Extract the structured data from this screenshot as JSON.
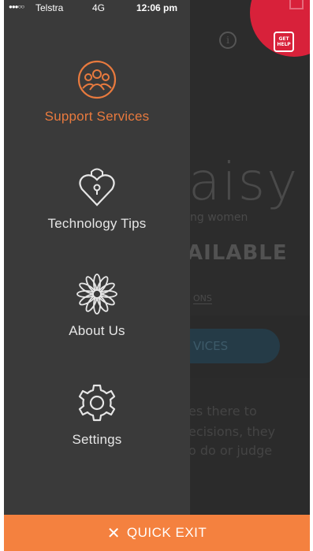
{
  "status_bar": {
    "signal": "●●●○○",
    "carrier": "Telstra",
    "network": "4G",
    "time": "12:06 pm"
  },
  "background": {
    "logo_text": "aisy",
    "tagline": "ng women",
    "available_text": "AILABLE",
    "options_text": "ONS",
    "services_button": "VICES",
    "body_lines": [
      "es there to",
      "ecisions, they",
      "o do or judge"
    ],
    "get_help_label_1": "GET",
    "get_help_label_2": "HELP",
    "info_glyph": "i"
  },
  "menu": {
    "items": [
      {
        "label": "Support Services",
        "icon": "people-circle-icon",
        "active": true
      },
      {
        "label": "Technology Tips",
        "icon": "heart-lock-icon",
        "active": false
      },
      {
        "label": "About Us",
        "icon": "flower-icon",
        "active": false
      },
      {
        "label": "Settings",
        "icon": "gear-icon",
        "active": false
      }
    ]
  },
  "quick_exit": {
    "icon": "✕",
    "label": "QUICK EXIT"
  },
  "colors": {
    "accent": "#e87a3e",
    "quick_exit_bg": "#f4813f",
    "drawer_bg": "#3a3a3a",
    "get_help_red": "#d8213a"
  }
}
